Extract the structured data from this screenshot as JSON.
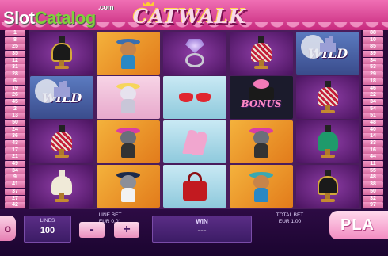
{
  "header": {
    "brand": "SlotCatalog",
    "brand_part1": "Slot",
    "brand_part2": "Catalog",
    "brand_suffix": ".com",
    "game_title": "CATWALK"
  },
  "paylines": {
    "left": [
      "1",
      "8",
      "25",
      "35",
      "12",
      "31",
      "28",
      "6",
      "19",
      "26",
      "45",
      "2",
      "13",
      "50",
      "24",
      "36",
      "43",
      "17",
      "21",
      "49",
      "34",
      "9",
      "41",
      "37",
      "27",
      "42"
    ],
    "right": [
      "88",
      "10",
      "85",
      "39",
      "34",
      "53",
      "29",
      "18",
      "46",
      "22",
      "34",
      "54",
      "51",
      "48",
      "40",
      "14",
      "33",
      "16",
      "44",
      "11",
      "55",
      "48",
      "38",
      "50",
      "32",
      "97"
    ]
  },
  "reels": [
    [
      {
        "symbol": "jewelry-bust-black"
      },
      {
        "symbol": "wild",
        "label": "WILD"
      },
      {
        "symbol": "jewelry-bust-red"
      },
      {
        "symbol": "jewelry-bust-white"
      }
    ],
    [
      {
        "symbol": "cat-umbrella"
      },
      {
        "symbol": "cat-blonde"
      },
      {
        "symbol": "cat-pink-hat"
      },
      {
        "symbol": "cat-sunglasses"
      }
    ],
    [
      {
        "symbol": "diamond-ring"
      },
      {
        "symbol": "red-sunglasses"
      },
      {
        "symbol": "pink-shoes"
      },
      {
        "symbol": "red-handbag"
      }
    ],
    [
      {
        "symbol": "jewelry-bust-red"
      },
      {
        "symbol": "bonus",
        "label": "BONUS"
      },
      {
        "symbol": "cat-pink-hat"
      },
      {
        "symbol": "cat-umbrella"
      }
    ],
    [
      {
        "symbol": "wild",
        "label": "WILD"
      },
      {
        "symbol": "jewelry-bust-red"
      },
      {
        "symbol": "jewelry-bust-green"
      },
      {
        "symbol": "jewelry-bust-black"
      }
    ]
  ],
  "controls": {
    "menu_label": "o",
    "lines_label": "LINES",
    "lines_value": "100",
    "line_bet_label": "LINE BET",
    "line_bet_value": "EUR 0.01",
    "minus_label": "-",
    "plus_label": "+",
    "win_label": "WIN",
    "win_value": "---",
    "total_bet_label": "TOTAL BET",
    "total_bet_value": "EUR 1.00",
    "play_label": "PLA"
  },
  "colors": {
    "header_pink": "#e44c9a",
    "reel_background": "#4a1d5c",
    "panel_purple": "#4a2476",
    "button_pink": "#f28cc2"
  }
}
